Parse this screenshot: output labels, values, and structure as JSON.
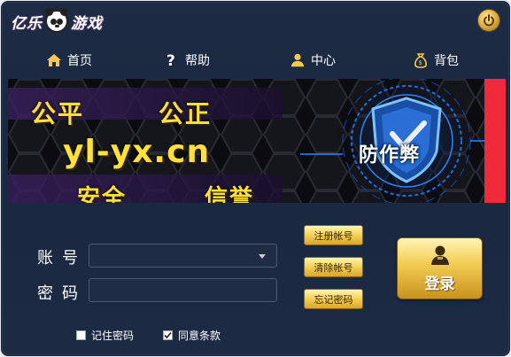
{
  "app": {
    "logo_left": "亿乐",
    "logo_right": "游戏",
    "power_icon": "power-icon"
  },
  "nav": [
    {
      "label": "首页",
      "icon": "home-icon"
    },
    {
      "label": "帮助",
      "icon": "help-icon"
    },
    {
      "label": "中心",
      "icon": "user-icon"
    },
    {
      "label": "背包",
      "icon": "bag-icon"
    }
  ],
  "banner": {
    "line1_left": "公平",
    "line1_right": "公正",
    "site": "yl-yx.cn",
    "line3_left": "安全",
    "line3_right": "信誉",
    "shield_text": "防作弊",
    "colors": {
      "text": "#ffe13a",
      "shield": "#1a4fa8",
      "strip": "#ee2a3b"
    }
  },
  "form": {
    "account_label": "账号",
    "password_label": "密码",
    "account_value": "",
    "password_value": "",
    "register_button": "注册帐号",
    "clear_button": "清除帐号",
    "forgot_button": "忘记密码",
    "login_button": "登录",
    "remember_label": "记住密码",
    "remember_checked": false,
    "agree_label": "同意条款",
    "agree_checked": true
  }
}
